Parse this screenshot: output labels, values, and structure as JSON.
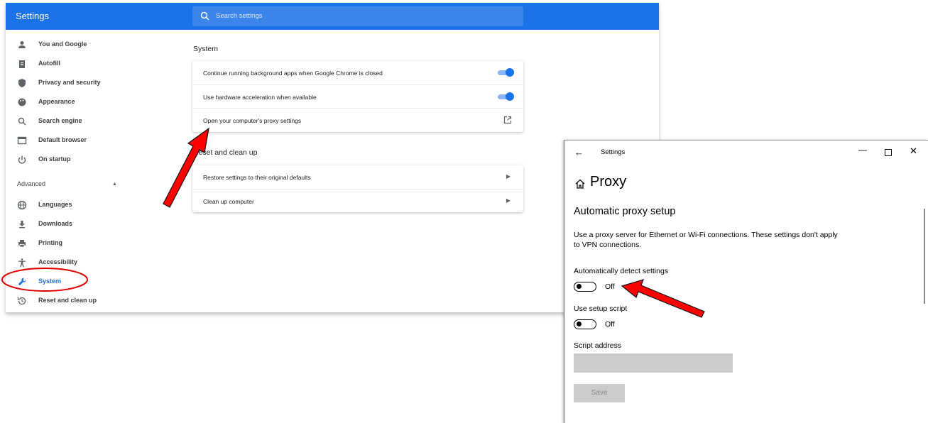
{
  "chrome": {
    "title": "Settings",
    "search_placeholder": "Search settings",
    "accent": "#1a73e8",
    "nav": {
      "items": [
        {
          "label": "You and Google",
          "icon": "person-icon"
        },
        {
          "label": "Autofill",
          "icon": "clipboard-icon"
        },
        {
          "label": "Privacy and security",
          "icon": "shield-icon"
        },
        {
          "label": "Appearance",
          "icon": "palette-icon"
        },
        {
          "label": "Search engine",
          "icon": "search-icon"
        },
        {
          "label": "Default browser",
          "icon": "browser-icon"
        },
        {
          "label": "On startup",
          "icon": "power-icon"
        }
      ],
      "advanced_label": "Advanced",
      "advanced_items": [
        {
          "label": "Languages",
          "icon": "globe-icon"
        },
        {
          "label": "Downloads",
          "icon": "download-icon"
        },
        {
          "label": "Printing",
          "icon": "printer-icon"
        },
        {
          "label": "Accessibility",
          "icon": "accessibility-icon"
        },
        {
          "label": "System",
          "icon": "wrench-icon",
          "active": true
        },
        {
          "label": "Reset and clean up",
          "icon": "history-icon"
        }
      ]
    },
    "system": {
      "title": "System",
      "rows": [
        {
          "label": "Continue running background apps when Google Chrome is closed",
          "control": "toggle",
          "on": true
        },
        {
          "label": "Use hardware acceleration when available",
          "control": "toggle",
          "on": true
        },
        {
          "label": "Open your computer's proxy settings",
          "control": "external-link-icon"
        }
      ]
    },
    "reset": {
      "title": "Reset and clean up",
      "rows": [
        {
          "label": "Restore settings to their original defaults"
        },
        {
          "label": "Clean up computer"
        }
      ]
    }
  },
  "windows": {
    "titlebar": "Settings",
    "back_icon": "back-arrow-icon",
    "heading": "Proxy",
    "section": "Automatic proxy setup",
    "description": "Use a proxy server for Ethernet or Wi-Fi connections. These settings don't apply to VPN connections.",
    "auto_detect": {
      "label": "Automatically detect settings",
      "state": "Off"
    },
    "setup_script": {
      "label": "Use setup script",
      "state": "Off"
    },
    "script_address": {
      "label": "Script address",
      "value": ""
    },
    "save_label": "Save"
  },
  "annotations": {
    "arrow_color": "#e00000",
    "circle_color": "#e00000"
  }
}
